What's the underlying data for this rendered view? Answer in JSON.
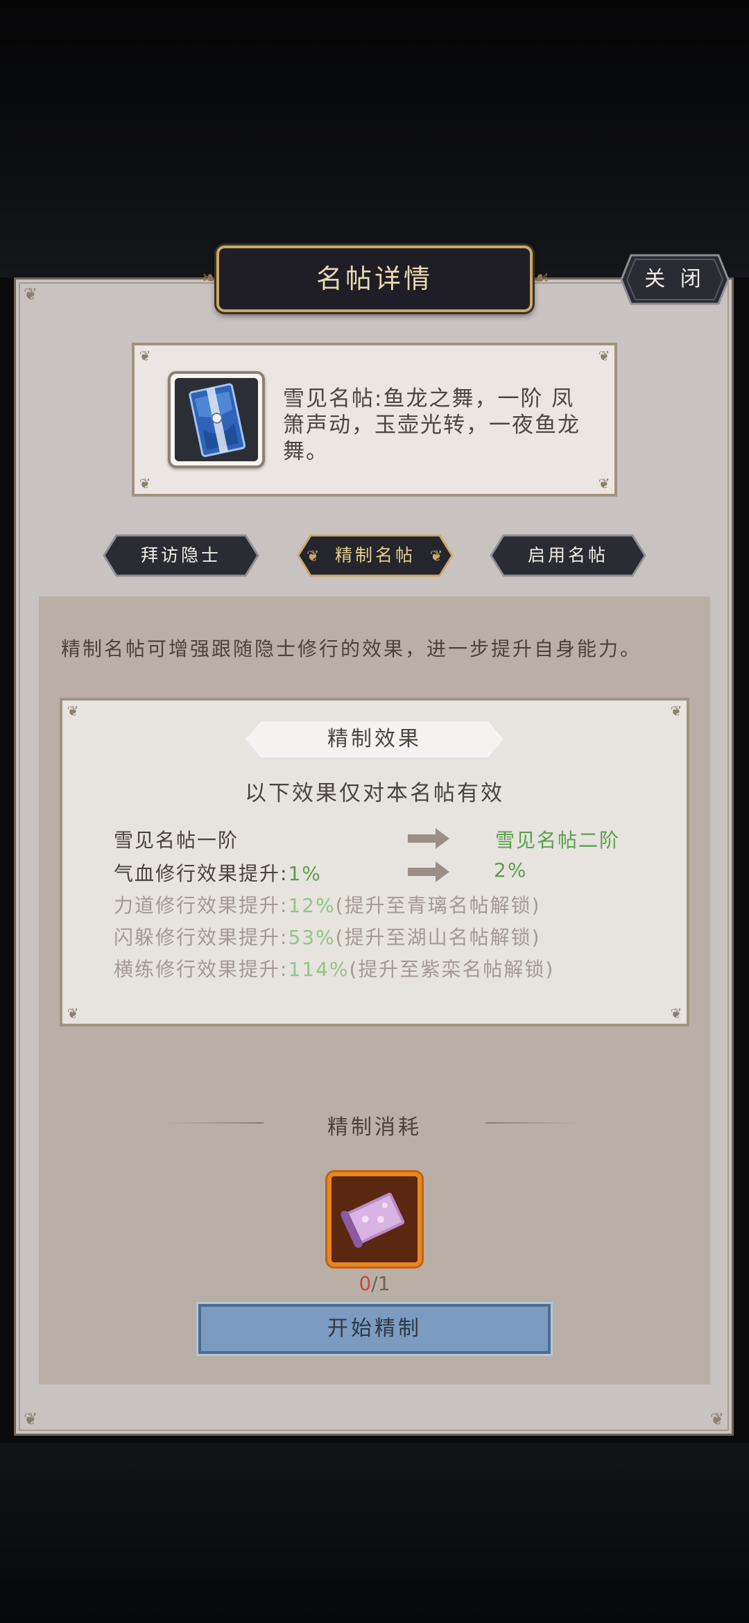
{
  "header": {
    "title": "名帖详情",
    "close_label": "关 闭"
  },
  "item": {
    "description": "雪见名帖:鱼龙之舞，一阶 凤箫声动，玉壶光转，一夜鱼龙舞。"
  },
  "tabs": [
    {
      "label": "拜访隐士",
      "active": false
    },
    {
      "label": "精制名帖",
      "active": true
    },
    {
      "label": "启用名帖",
      "active": false
    }
  ],
  "intro": "精制名帖可增强跟随隐士修行的效果，进一步提升自身能力。",
  "effect": {
    "title": "精制效果",
    "subtitle": "以下效果仅对本名帖有效",
    "current_rank": "雪见名帖一阶",
    "next_rank": "雪见名帖二阶",
    "rows": [
      {
        "label": "气血修行效果提升:",
        "value": "1%",
        "next": "2%"
      },
      {
        "label": "力道修行效果提升:",
        "value": "12%",
        "note": "(提升至青璃名帖解锁)"
      },
      {
        "label": "闪躲修行效果提升:",
        "value": "53%",
        "note": "(提升至湖山名帖解锁)"
      },
      {
        "label": "横练修行效果提升:",
        "value": "114%",
        "note": "(提升至紫栾名帖解锁)"
      }
    ]
  },
  "cost": {
    "title": "精制消耗",
    "have": "0",
    "need": "/1",
    "button_label": "开始精制"
  },
  "colors": {
    "accent_gold": "#c9a869",
    "unlocked_green": "#5aa04a",
    "button_blue": "#7b9bc0",
    "deficit_red": "#c64a3a"
  }
}
